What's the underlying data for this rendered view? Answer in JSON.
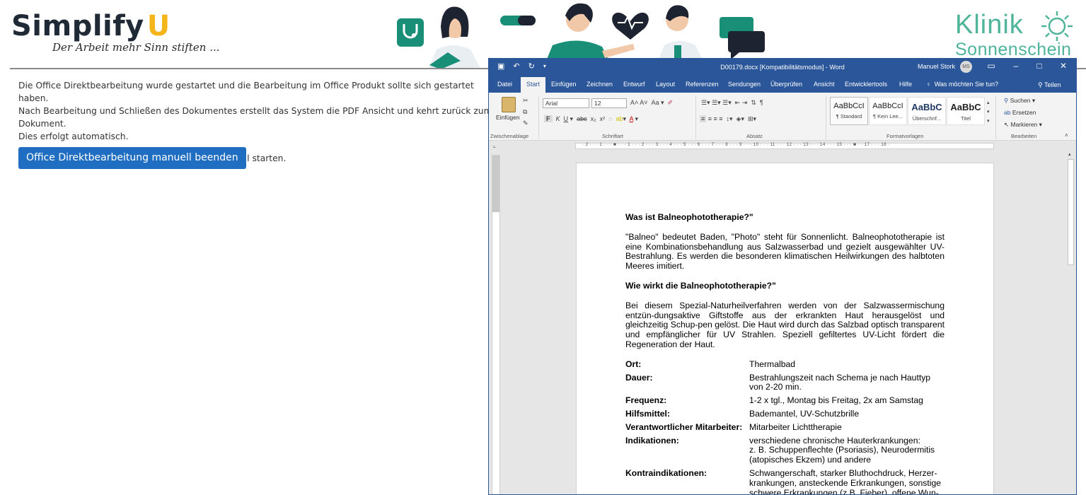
{
  "header": {
    "logo_main": "Simplify",
    "logo_u": "U",
    "logo_tagline": "Der Arbeit mehr Sinn stiften ...",
    "klinik_line1": "Klinik",
    "klinik_line2": "Sonnenschein"
  },
  "colors": {
    "brand_teal": "#4fb49a",
    "brand_yellow": "#f3b51a",
    "button_blue": "#1f6ec2",
    "word_blue": "#2b579a"
  },
  "left": {
    "line1": "Die Office Direktbearbeitung wurde gestartet und die Bearbeitung im Office Produkt sollte sich gestartet haben.",
    "line2": "Nach Bearbeitung und Schließen des Dokumentes erstellt das System die PDF Ansicht und kehrt zurück zum Dokument.",
    "line3": "Dies erfolgt automatisch.",
    "line4": "Bei Bedarf können Sie die Generierung auch manuell starten.",
    "button_label": "Office Direktbearbeitung manuell beenden"
  },
  "word": {
    "title": "D00179.docx [Kompatibilitätsmodus] - Word",
    "user": "Manuel Stork",
    "user_initials": "MS",
    "tabs": [
      "Datei",
      "Start",
      "Einfügen",
      "Zeichnen",
      "Entwurf",
      "Layout",
      "Referenzen",
      "Sendungen",
      "Überprüfen",
      "Ansicht",
      "Entwicklertools",
      "Hilfe"
    ],
    "active_tab": "Start",
    "tell_me": "Was möchten Sie tun?",
    "share": "Teilen",
    "ribbon": {
      "paste": "Einfügen",
      "clipboard": "Zwischenablage",
      "font_name": "Arial",
      "font_size": "12",
      "font_group": "Schriftart",
      "paragraph_group": "Absatz",
      "styles_group": "Formatvorlagen",
      "editing_group": "Bearbeiten",
      "styles": [
        {
          "sample": "AaBbCcI",
          "name": "¶ Standard"
        },
        {
          "sample": "AaBbCcI",
          "name": "¶ Kein Lee..."
        },
        {
          "sample": "AaBbC",
          "name": "Überschrif..."
        },
        {
          "sample": "AaBbC",
          "name": "Titel"
        }
      ],
      "find": "Suchen",
      "replace": "Ersetzen",
      "select": "Markieren"
    },
    "ruler_ticks": "· 2 · · · 1 · · · ■ · · · 1 · · · 2 · · · 3 · · · 4 · · · 5 · · · 6 · · · 7 · · · 8 · · · 9 · · · 10 · · · 11 · · · 12 · · · 13 · · · 14 · · · 15 · · · ■ · · 17 · · · 18 ·"
  },
  "document": {
    "h1": "Was ist Balneophototherapie?\"",
    "p1": "\"Balneo\" bedeutet Baden, \"Photo\" steht für Sonnenlicht. Balneophototherapie ist eine Kombinationsbehandlung aus Salzwasserbad und gezielt ausgewählter UV-Bestrahlung. Es werden die besonderen klimatischen Heilwirkungen des halbtoten Meeres imitiert.",
    "h2": "Wie wirkt die Balneophototherapie?\"",
    "p2": "Bei diesem Spezial-Naturheilverfahren werden von der Salzwassermischung entzün-dungsaktive Giftstoffe aus der erkrankten Haut herausgelöst und gleichzeitig Schup-pen gelöst. Die Haut wird durch das Salzbad optisch transparent und empfänglicher für UV Strahlen. Speziell gefiltertes UV-Licht fördert die Regeneration der Haut.",
    "rows": [
      {
        "label": "Ort:",
        "value": "Thermalbad"
      },
      {
        "label": "Dauer:",
        "value": "Bestrahlungszeit nach Schema je nach Hauttyp\nvon 2-20 min."
      },
      {
        "label": "Frequenz:",
        "value": "1-2 x tgl., Montag bis Freitag, 2x am Samstag"
      },
      {
        "label": "Hilfsmittel:",
        "value": "Bademantel, UV-Schutzbrille"
      },
      {
        "label": "Verantwortlicher Mitarbeiter:",
        "value": "Mitarbeiter Lichttherapie"
      },
      {
        "label": "Indikationen:",
        "value": "verschiedene chronische Hauterkrankungen:\nz. B. Schuppenflechte (Psoriasis), Neurodermitis\n(atopisches Ekzem) und andere"
      },
      {
        "label": "Kontraindikationen:",
        "value": "Schwangerschaft, starker Bluthochdruck, Herzer-\nkrankungen, ansteckende Erkrankungen, sonstige\nschwere Erkrankungen (z.B. Fieber), offene Wun-\nden"
      }
    ]
  }
}
